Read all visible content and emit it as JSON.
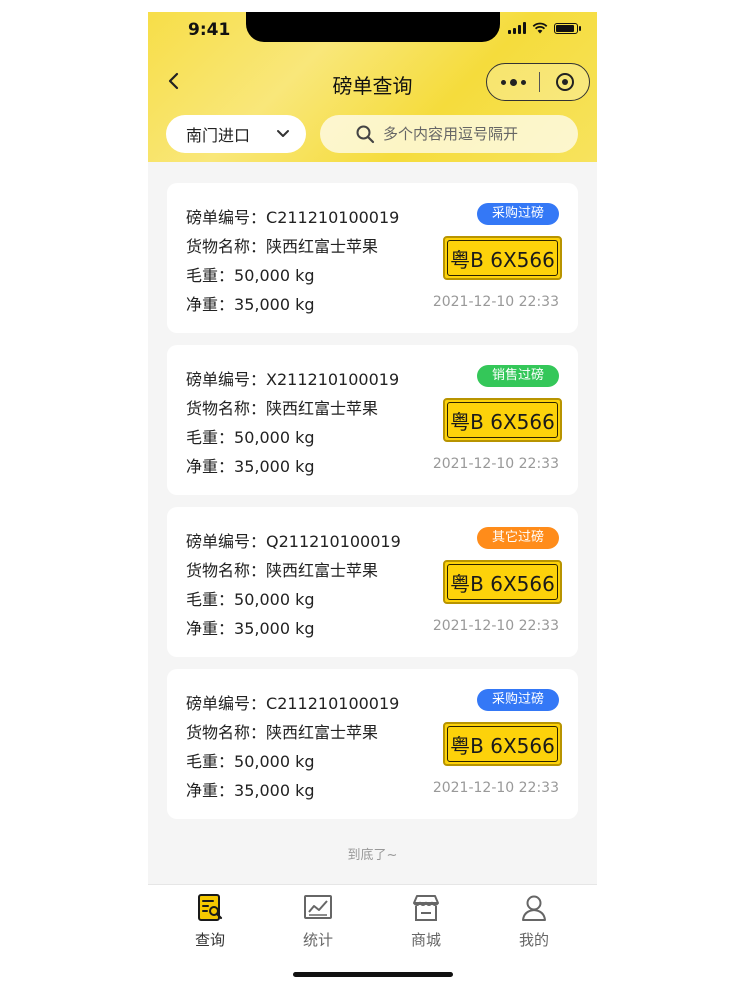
{
  "status_bar": {
    "time": "9:41"
  },
  "nav": {
    "title": "磅单查询"
  },
  "filter": {
    "gate": "南门进口",
    "search_placeholder": "多个内容用逗号隔开"
  },
  "labels": {
    "ticket_no": "磅单编号：",
    "goods": "货物名称：",
    "gross": "毛重：",
    "net": "净重："
  },
  "colors": {
    "header_yellow": "#f7de48",
    "badge_purchase": "#3478f6",
    "badge_sales": "#34c759",
    "badge_other": "#ff8c1a",
    "plate_yellow": "#fdd20a"
  },
  "records": [
    {
      "ticket_no": "C211210100019",
      "goods": "陕西红富士苹果",
      "gross": "50,000 kg",
      "net": "35,000 kg",
      "badge": "采购过磅",
      "badge_type": "purchase",
      "plate": "粤B 6X566",
      "time": "2021-12-10  22:33"
    },
    {
      "ticket_no": "X211210100019",
      "goods": "陕西红富士苹果",
      "gross": "50,000 kg",
      "net": "35,000 kg",
      "badge": "销售过磅",
      "badge_type": "sales",
      "plate": "粤B 6X566",
      "time": "2021-12-10  22:33"
    },
    {
      "ticket_no": "Q211210100019",
      "goods": "陕西红富士苹果",
      "gross": "50,000 kg",
      "net": "35,000 kg",
      "badge": "其它过磅",
      "badge_type": "other",
      "plate": "粤B 6X566",
      "time": "2021-12-10  22:33"
    },
    {
      "ticket_no": "C211210100019",
      "goods": "陕西红富士苹果",
      "gross": "50,000 kg",
      "net": "35,000 kg",
      "badge": "采购过磅",
      "badge_type": "purchase",
      "plate": "粤B 6X566",
      "time": "2021-12-10  22:33"
    }
  ],
  "list_end": "到底了~",
  "tabbar": {
    "items": [
      {
        "label": "查询",
        "icon": "query-icon",
        "active": true
      },
      {
        "label": "统计",
        "icon": "chart-icon",
        "active": false
      },
      {
        "label": "商城",
        "icon": "store-icon",
        "active": false
      },
      {
        "label": "我的",
        "icon": "user-icon",
        "active": false
      }
    ]
  }
}
